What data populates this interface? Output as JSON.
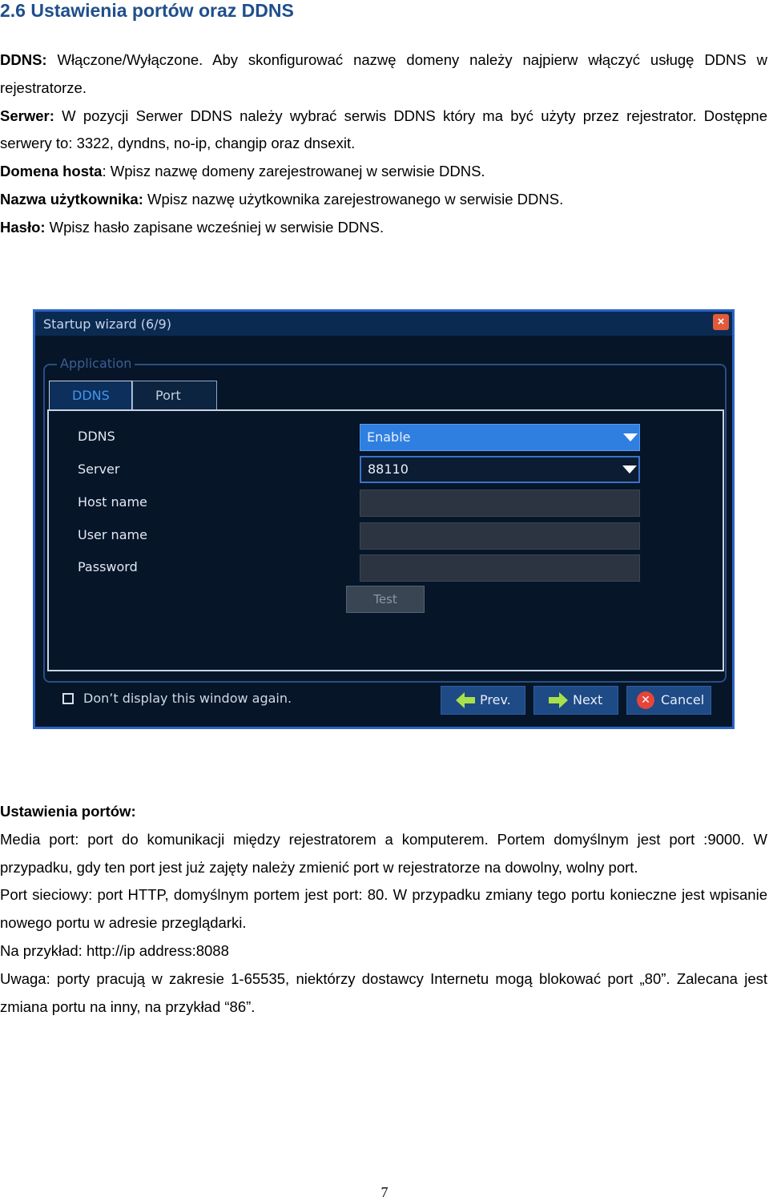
{
  "heading": "2.6 Ustawienia portów oraz DDNS",
  "intro": [
    {
      "bold": "DDNS:",
      "text": " Włączone/Wyłączone. Aby skonfigurować nazwę domeny należy najpierw włączyć usługę DDNS w rejestratorze."
    },
    {
      "bold": "Serwer:",
      "text": " W pozycji Serwer DDNS należy wybrać serwis DDNS który ma być użyty przez rejestrator. Dostępne serwery to: 3322, dyndns, no-ip, changip oraz dnsexit."
    },
    {
      "bold": "Domena hosta",
      "text": ": Wpisz nazwę domeny zarejestrowanej w serwisie DDNS."
    },
    {
      "bold": "Nazwa użytkownika:",
      "text": " Wpisz nazwę użytkownika zarejestrowanego w serwisie DDNS."
    },
    {
      "bold": "Hasło:",
      "text": " Wpisz hasło zapisane wcześniej w serwisie DDNS."
    }
  ],
  "dialog": {
    "title": "Startup wizard (6/9)",
    "close": "×",
    "group_label": "Application",
    "tabs": [
      "DDNS",
      "Port"
    ],
    "labels": {
      "ddns": "DDNS",
      "server": "Server",
      "host": "Host name",
      "user": "User name",
      "password": "Password"
    },
    "ddns_value": "Enable",
    "server_value": "88110",
    "test_button": "Test",
    "checkbox_label": "Don’t display this window again.",
    "prev_button": "Prev.",
    "next_button": "Next",
    "cancel_button": "Cancel",
    "colors": {
      "accent": "#2f7fe0",
      "background": "#061528",
      "border": "#2a63c8"
    }
  },
  "ports": {
    "title": "Ustawienia portów:",
    "p1": "Media port: port do komunikacji między rejestratorem a komputerem. Portem domyślnym jest port :9000. W przypadku, gdy ten port jest już zajęty należy zmienić port w rejestratorze na  dowolny, wolny port.",
    "p2": "Port sieciowy: port HTTP, domyślnym portem jest port: 80. W przypadku zmiany tego portu konieczne jest wpisanie nowego portu w adresie przeglądarki.",
    "p3": "Na przykład: http://ip address:8088",
    "p4": "Uwaga: porty pracują w zakresie 1-65535, niektórzy dostawcy Internetu mogą blokować port „80”. Zalecana jest zmiana portu na inny, na przykład “86”."
  },
  "page_number": "7"
}
